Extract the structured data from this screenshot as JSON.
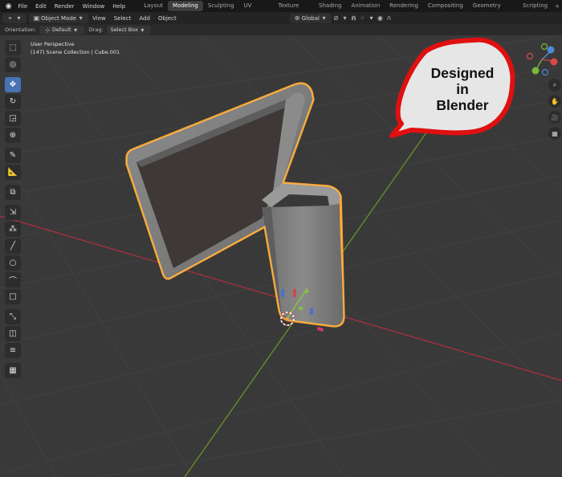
{
  "topbar": {
    "menus": [
      "File",
      "Edit",
      "Render",
      "Window",
      "Help"
    ],
    "workspaces": [
      "Layout",
      "Modeling",
      "Sculpting",
      "UV Editing",
      "Texture Paint",
      "Shading",
      "Animation",
      "Rendering",
      "Compositing",
      "Geometry Nodes",
      "Scripting"
    ],
    "active_workspace": "Modeling",
    "add_tab": "+"
  },
  "header": {
    "mode": "Object Mode",
    "menus": [
      "View",
      "Select",
      "Add",
      "Object"
    ],
    "transform_orientation": "Global"
  },
  "tool_settings": {
    "orientation_label": "Orientation:",
    "orientation_value": "Default",
    "drag_label": "Drag:",
    "drag_value": "Select Box"
  },
  "viewport": {
    "perspective": "User Perspective",
    "collection_info": "(147) Scene Collection | Cube.001"
  },
  "bubble": {
    "line1": "Designed",
    "line2": "in",
    "line3": "Blender"
  },
  "colors": {
    "viewport_bg": "#393939",
    "selection_outline": "#f0a030",
    "x_axis": "#b03040",
    "y_axis": "#6a9a2a",
    "active_tool": "#4772b3",
    "bubble_border": "#e01010"
  },
  "icons": {
    "toolbar": [
      "select-box-icon",
      "cursor-icon",
      "move-icon",
      "rotate-icon",
      "scale-icon",
      "transform-icon",
      "annotate-icon",
      "measure-icon",
      "add-cube-icon",
      "extrude-icon",
      "spin-icon",
      "bevel-icon",
      "loopcut-icon",
      "knife-icon",
      "poly-build-icon",
      "shear-icon",
      "smooth-icon",
      "grid-icon"
    ],
    "nav": [
      "zoom-icon",
      "hand-icon",
      "camera-icon",
      "grid-view-icon"
    ]
  }
}
